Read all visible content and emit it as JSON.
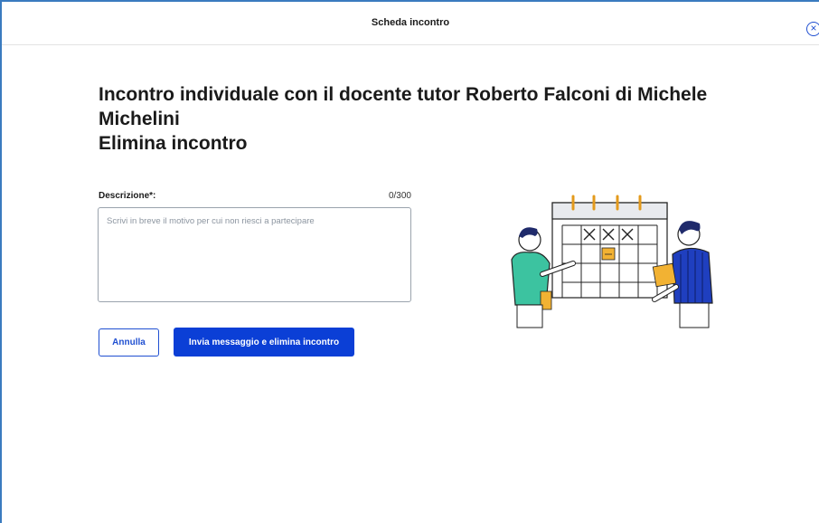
{
  "header": {
    "title": "Scheda incontro",
    "close_icon": "close-circle-icon"
  },
  "main": {
    "title_line1": "Incontro individuale con il docente tutor Roberto Falconi di Michele Michelini",
    "title_line2": "Elimina incontro",
    "description_label": "Descrizione*:",
    "description_counter": "0/300",
    "description_value": "",
    "description_placeholder": "Scrivi in breve il motivo per cui non riesci a partecipare",
    "cancel_label": "Annulla",
    "submit_label": "Invia messaggio e elimina incontro"
  },
  "colors": {
    "accent": "#0b3fd6",
    "frame": "#3a7bbf",
    "text": "#1a1a1a"
  },
  "illustration": {
    "icon": "calendar-meeting-illustration"
  }
}
